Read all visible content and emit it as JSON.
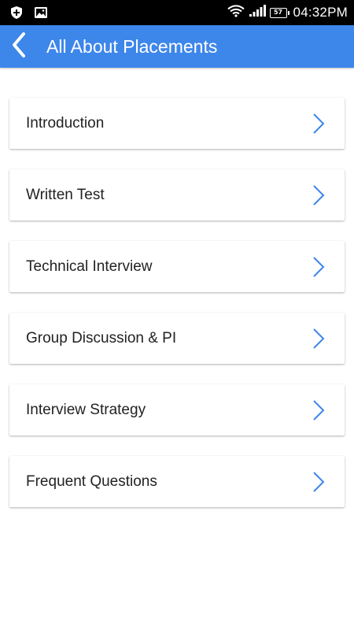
{
  "status_bar": {
    "time": "04:32PM",
    "battery_level": "57",
    "icons": [
      "shield-plus-icon",
      "image-icon",
      "wifi-icon",
      "signal-icon",
      "battery-icon"
    ]
  },
  "app_bar": {
    "title": "All About Placements",
    "back_icon": "chevron-left-icon",
    "color": "#3d86ea"
  },
  "menu": {
    "items": [
      {
        "label": "Introduction"
      },
      {
        "label": "Written Test"
      },
      {
        "label": "Technical Interview"
      },
      {
        "label": "Group Discussion & PI"
      },
      {
        "label": "Interview Strategy"
      },
      {
        "label": "Frequent Questions"
      }
    ],
    "chevron_icon": "chevron-right-icon",
    "chevron_color": "#3d86ea"
  }
}
